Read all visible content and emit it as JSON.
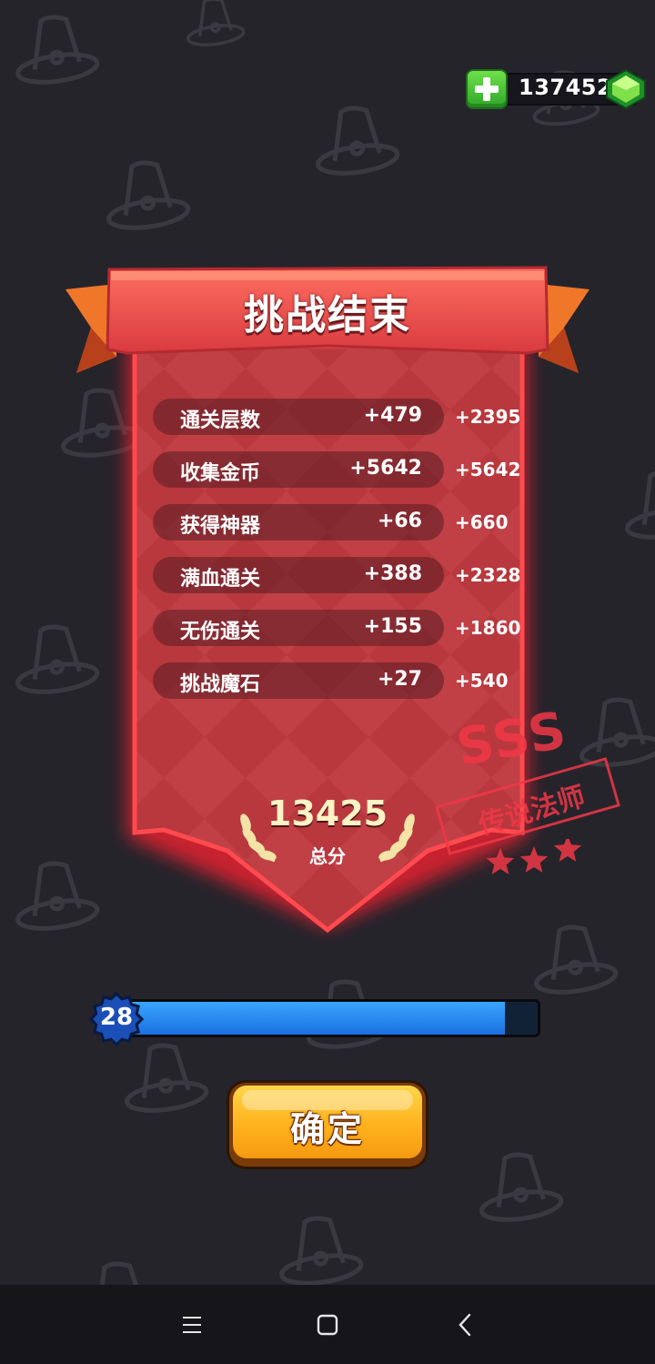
{
  "currency": {
    "amount": "137452",
    "add_icon": "plus-icon",
    "gem_icon": "green-gem-icon"
  },
  "banner": {
    "title": "挑战结束",
    "color": "#c9383b"
  },
  "rows": [
    {
      "label": "通关层数",
      "count": "+479",
      "bonus": "+2395"
    },
    {
      "label": "收集金币",
      "count": "+5642",
      "bonus": "+5642"
    },
    {
      "label": "获得神器",
      "count": "+66",
      "bonus": "+660"
    },
    {
      "label": "满血通关",
      "count": "+388",
      "bonus": "+2328"
    },
    {
      "label": "无伤通关",
      "count": "+155",
      "bonus": "+1860"
    },
    {
      "label": "挑战魔石",
      "count": "+27",
      "bonus": "+540"
    }
  ],
  "total": {
    "score": "13425",
    "label": "总分"
  },
  "stamp": {
    "grade": "SSS",
    "title": "传说法师",
    "stars": 3
  },
  "level": {
    "number": "28",
    "progress": 0.92
  },
  "confirm": {
    "label": "确定"
  },
  "nav": {
    "menu_icon": "menu-icon",
    "home_icon": "home-square-icon",
    "back_icon": "back-chevron-icon"
  }
}
